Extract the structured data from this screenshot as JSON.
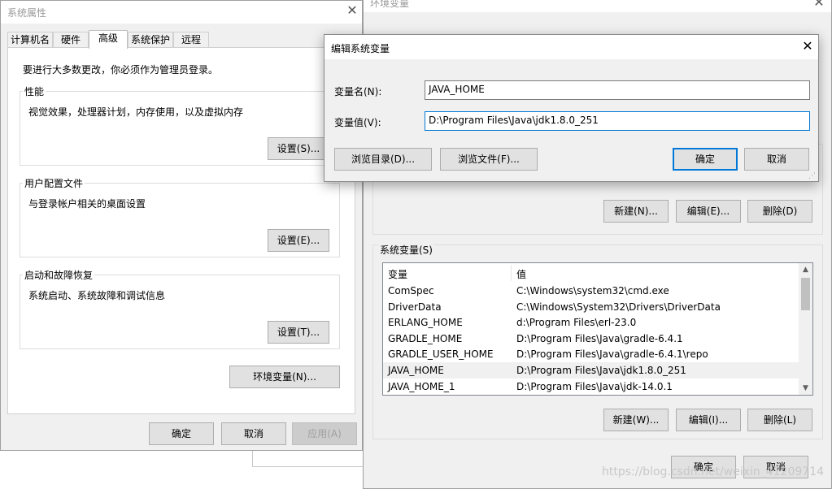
{
  "sys_props": {
    "title": "系统属性",
    "tabs": [
      "计算机名",
      "硬件",
      "高级",
      "系统保护",
      "远程"
    ],
    "admin_note": "要进行大多数更改，你必须作为管理员登录。",
    "performance": {
      "title": "性能",
      "desc": "视觉效果，处理器计划，内存使用，以及虚拟内存",
      "button": "设置(S)..."
    },
    "user_profile": {
      "title": "用户配置文件",
      "desc": "与登录帐户相关的桌面设置",
      "button": "设置(E)..."
    },
    "startup": {
      "title": "启动和故障恢复",
      "desc": "系统启动、系统故障和调试信息",
      "button": "设置(T)..."
    },
    "env_button": "环境变量(N)...",
    "ok": "确定",
    "cancel": "取消",
    "apply": "应用(A)"
  },
  "env_vars": {
    "title": "环境变量",
    "user_buttons": {
      "new": "新建(N)...",
      "edit": "编辑(E)...",
      "delete": "删除(D)"
    },
    "system_section": "系统变量(S)",
    "columns": {
      "name": "变量",
      "value": "值"
    },
    "rows": [
      {
        "name": "ComSpec",
        "value": "C:\\Windows\\system32\\cmd.exe"
      },
      {
        "name": "DriverData",
        "value": "C:\\Windows\\System32\\Drivers\\DriverData"
      },
      {
        "name": "ERLANG_HOME",
        "value": "d:\\Program Files\\erl-23.0"
      },
      {
        "name": "GRADLE_HOME",
        "value": "D:\\Program Files\\Java\\gradle-6.4.1"
      },
      {
        "name": "GRADLE_USER_HOME",
        "value": "D:\\Program Files\\Java\\gradle-6.4.1\\repo"
      },
      {
        "name": "JAVA_HOME",
        "value": "D:\\Program Files\\Java\\jdk1.8.0_251"
      },
      {
        "name": "JAVA_HOME_1",
        "value": "D:\\Program Files\\Java\\jdk-14.0.1"
      }
    ],
    "selected_row": "JAVA_HOME",
    "system_buttons": {
      "new": "新建(W)...",
      "edit": "编辑(I)...",
      "delete": "删除(L)"
    },
    "ok": "确定",
    "cancel": "取消"
  },
  "edit_dialog": {
    "title": "编辑系统变量",
    "name_label": "变量名(N):",
    "name_value": "JAVA_HOME",
    "value_label": "变量值(V):",
    "value_value": "D:\\Program Files\\Java\\jdk1.8.0_251",
    "browse_dir": "浏览目录(D)...",
    "browse_file": "浏览文件(F)...",
    "ok": "确定",
    "cancel": "取消"
  },
  "watermark": "https://blog.csdn.net/weixin_41209714",
  "colors": {
    "accent": "#0078d7",
    "selected_row": "#f0f0f0",
    "dialog_bg": "#f0f0f0"
  },
  "icons": {
    "close": "close-icon",
    "scroll_up": "chevron-up-icon",
    "scroll_down": "chevron-down-icon"
  }
}
